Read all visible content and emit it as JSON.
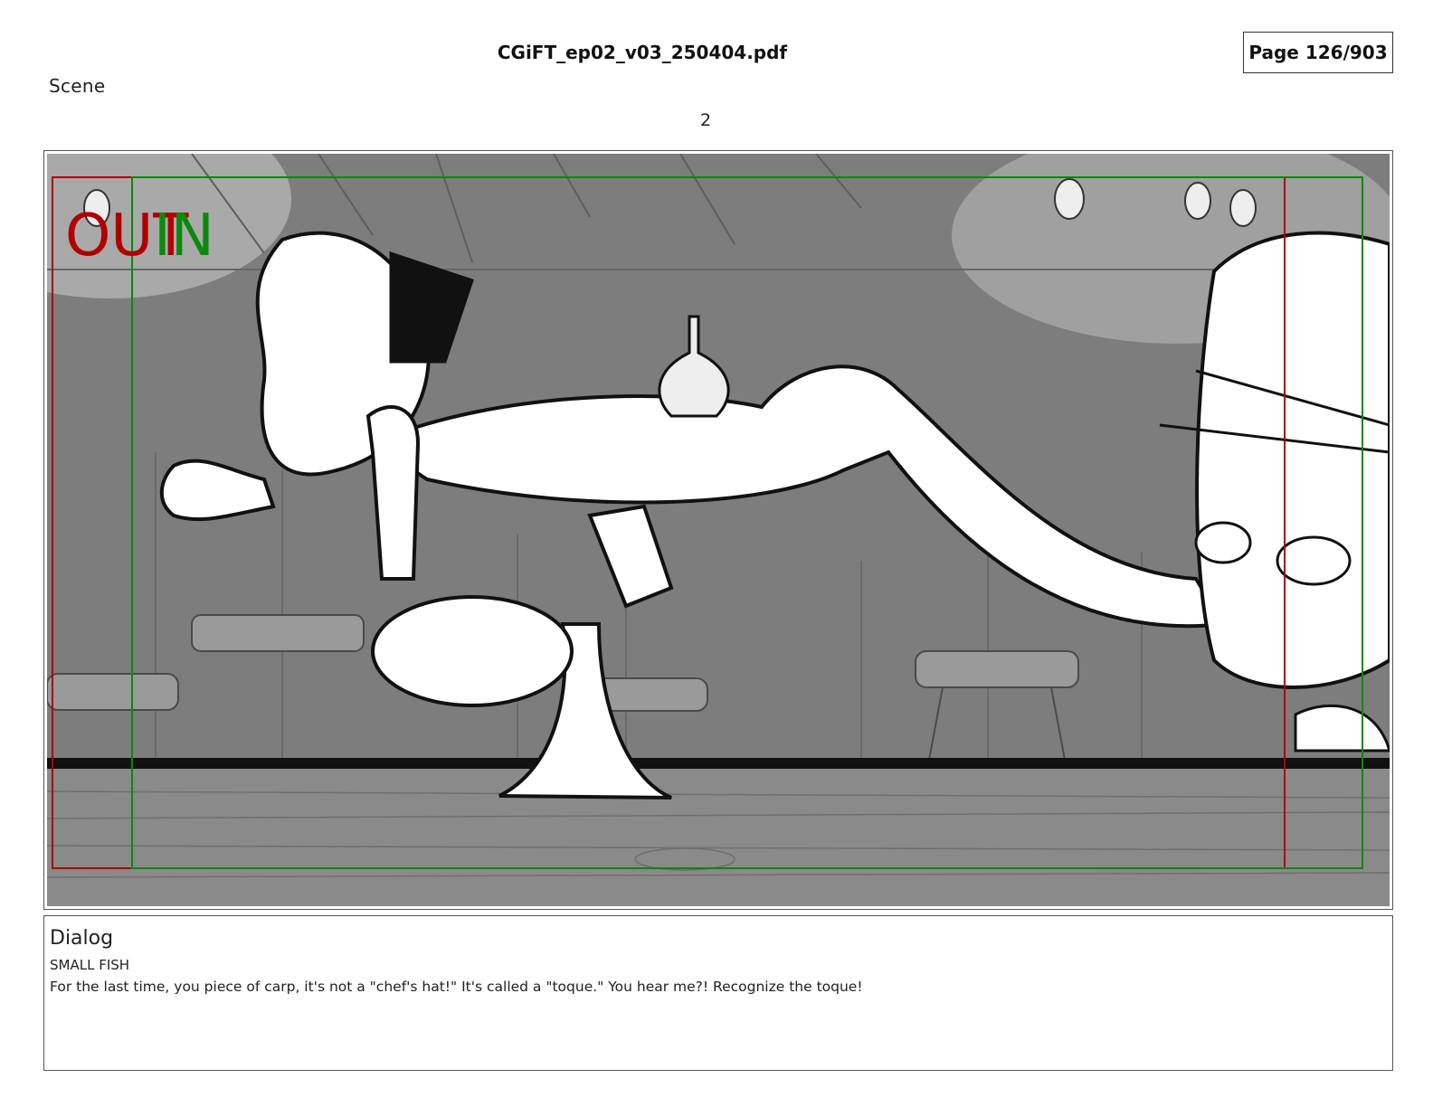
{
  "header": {
    "document_title": "CGiFT_ep02_v03_250404.pdf",
    "page_indicator": "Page 126/903"
  },
  "scene": {
    "label": "Scene",
    "number": "2"
  },
  "panel": {
    "out_marker": "OUT",
    "in_marker": "IN",
    "colors": {
      "out_frame": "#b00000",
      "in_frame": "#0a8a0a",
      "background": "#7a7a7a",
      "floor": "#8d8d8d"
    }
  },
  "dialog": {
    "heading": "Dialog",
    "speaker": "SMALL FISH",
    "line": "For the last time, you piece of carp, it's not a \"chef's hat!\" It's called a \"toque.\" You hear me?! Recognize the toque!"
  }
}
